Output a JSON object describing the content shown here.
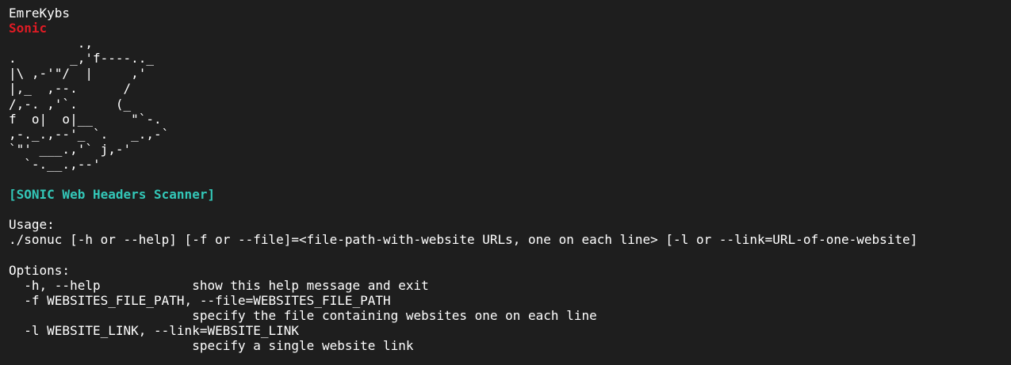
{
  "terminal": {
    "author": "EmreKybs",
    "tool_name": "Sonic",
    "ascii_art": [
      "         .,",
      ".       _,'f----.._",
      "|\\ ,-'\"/  |     ,'",
      "|,_  ,--.      /",
      "/,-. ,'`.     (_",
      "f  o|  o|__     \"`-.",
      ",-._.,--'_ `.   _.,-`",
      "`\"' ___.,'` j,-'",
      "  `-.__.,--'"
    ],
    "banner": "[SONIC Web Headers Scanner]",
    "usage_header": "Usage:",
    "usage_line": "./sonuc [-h or --help] [-f or --file]=<file-path-with-website URLs, one on each line> [-l or --link=URL-of-one-website]",
    "options_header": "Options:",
    "options_lines": [
      "  -h, --help            show this help message and exit",
      "  -f WEBSITES_FILE_PATH, --file=WEBSITES_FILE_PATH",
      "                        specify the file containing websites one on each line",
      "  -l WEBSITE_LINK, --link=WEBSITE_LINK",
      "                        specify a single website link"
    ]
  },
  "colors": {
    "background": "#1e1e1e",
    "text": "#ffffff",
    "tool_name": "#e01b24",
    "banner": "#33c7b8"
  }
}
